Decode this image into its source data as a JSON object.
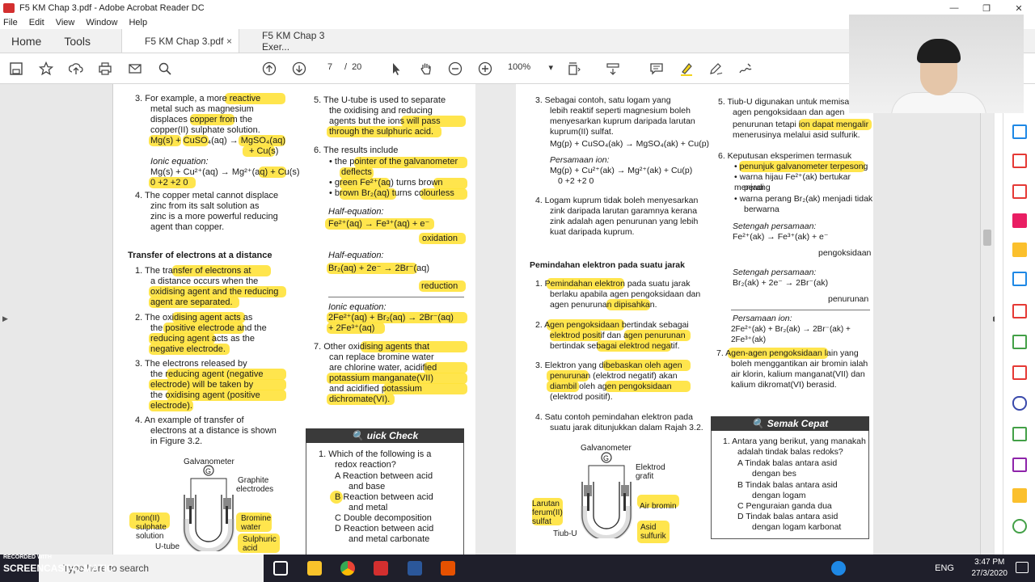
{
  "window": {
    "title": "F5 KM Chap 3.pdf - Adobe Acrobat Reader DC",
    "minimize": "—",
    "restore": "❐",
    "close": "✕"
  },
  "menu": [
    "File",
    "Edit",
    "View",
    "Window",
    "Help"
  ],
  "tabs": {
    "home": "Home",
    "tools": "Tools",
    "doc1": "F5 KM Chap 3.pdf",
    "doc1_close": "×",
    "doc2": "F5 KM Chap 3 Exer..."
  },
  "toolbar": {
    "page_current": "7",
    "page_sep": "/",
    "page_total": "20",
    "zoom": "100%",
    "zoom_arrow": "▾"
  },
  "page1": {
    "c1": {
      "l1": "3.   For example, a more reactive",
      "l2": "metal  such  as  magnesium",
      "l3": "displaces  copper  from  the",
      "l4": "copper(II) sulphate solution.",
      "l5": "Mg(s) + CuSO₄(aq) → MgSO₄(aq)",
      "l6": "+ Cu(s)",
      "l7": "Ionic equation:",
      "l8": "Mg(s) + Cu²⁺(aq) → Mg²⁺(aq) + Cu(s)",
      "l9": "0   +2             +2             0",
      "l10": "4.   The copper metal cannot displace",
      "l11": "zinc  from  its  salt  solution  as",
      "l12": "zinc is a more powerful reducing",
      "l13": "agent than copper.",
      "heading": "Transfer of electrons at a distance",
      "l14": "1.   The  transfer of electrons  at",
      "l15": "a  distance  occurs  when  the",
      "l16": "oxidising agent and the reducing",
      "l17": "agent are separated.",
      "l18": "2.   The  oxidising  agent  acts  as",
      "l19": "the  positive electrode  and  the",
      "l20": "reducing  agent  acts  as  the",
      "l21": "negative electrode.",
      "l22": "3.   The  electrons  released  by",
      "l23": "the  reducing agent  (negative",
      "l24": "electrode)  will  be  taken  by",
      "l25": "the  oxidising agent  (positive",
      "l26": "electrode).",
      "l27": "4.   An  example  of  transfer  of",
      "l28": "electrons at a distance is shown",
      "l29": "in Figure 3.2."
    },
    "c2": {
      "l1": "5.   The U-tube is used to separate",
      "l2": "the  oxidising  and  reducing",
      "l3": "agents but the ions will pass",
      "l4": "through the sulphuric acid.",
      "l5": "6.   The results include",
      "l6": "•  the pointer of the galvanometer",
      "l7": "deflects",
      "l8": "•  green Fe²⁺(aq) turns brown",
      "l9": "•  brown Br₂(aq) turns colourless",
      "l10": "Half-equation:",
      "l11": "Fe²⁺(aq) → Fe³⁺(aq) + e⁻",
      "l12": "oxidation",
      "l13": "Half-equation:",
      "l14": "Br₂(aq) + 2e⁻ → 2Br⁻(aq)",
      "l15": "reduction",
      "l16": "Ionic equation:",
      "l17": "2Fe²⁺(aq) + Br₂(aq) → 2Br⁻(aq)",
      "l18": "+ 2Fe³⁺(aq)",
      "l19": "7.   Other  oxidising agents  that",
      "l20": "can  replace  bromine  water",
      "l21": "are  chlorine  water,  acidified",
      "l22": "potassium  manganate(VII)",
      "l23": "and  acidified  potassium",
      "l24": "dichromate(VI)."
    },
    "fig": {
      "galv": "Galvanometer",
      "g": "G",
      "graphite": "Graphite",
      "electrodes": "electrodes",
      "iron1": "Iron(II)",
      "iron2": "sulphate",
      "iron3": "solution",
      "br1": "Bromine",
      "br2": "water",
      "sa1": "Sulphuric",
      "sa2": "acid",
      "utube": "U-tube"
    },
    "qc": {
      "title": "uick Check",
      "q1": "1.   Which of the following is a",
      "q2": "redox reaction?",
      "a1": "A   Reaction  between  acid",
      "a2": "and base",
      "b1": "B   Reaction  between  acid",
      "b2": "and metal",
      "c1": "C   Double decomposition",
      "d1": "D   Reaction  between  acid",
      "d2": "and metal carbonate"
    }
  },
  "page2": {
    "c1": {
      "l1": "3.   Sebagai  contoh,  satu  logam  yang",
      "l2": "lebih reaktif seperti magnesium boleh",
      "l3": "menyesarkan kuprum daripada larutan",
      "l4": "kuprum(II) sulfat.",
      "l5": "Mg(p) + CuSO₄(ak) → MgSO₄(ak) + Cu(p)",
      "l6": "Persamaan ion:",
      "l7": "Mg(p) + Cu²⁺(ak) → Mg²⁺(ak) + Cu(p)",
      "l8": "0         +2              +2              0",
      "l9": "4.   Logam kuprum tidak boleh menyesarkan",
      "l10": "zink daripada larutan garamnya kerana",
      "l11": "zink adalah agen penurunan yang lebih",
      "l12": "kuat daripada kuprum.",
      "heading": "Pemindahan elektron pada suatu jarak",
      "l13": "1.   Pemindahan elektron pada suatu jarak",
      "l14": "berlaku apabila agen pengoksidaan dan",
      "l15": "agen penurunan dipisahkan.",
      "l16": "2.   Agen pengoksidaan bertindak sebagai",
      "l17": "elektrod positif dan agen penurunan",
      "l18": "bertindak sebagai elektrod negatif.",
      "l19": "3.   Elektron yang dibebaskan oleh agen",
      "l20": "penurunan (elektrod negatif) akan",
      "l21": "diambil  oleh  agen pengoksidaan",
      "l22": "(elektrod positif).",
      "l23": "4.   Satu contoh pemindahan elektron pada",
      "l24": "suatu jarak ditunjukkan dalam Rajah 3.2."
    },
    "c2": {
      "l1": "5.   Tiub-U digunakan untuk memisahkan",
      "l2": "agen  pengoksidaan  dan  agen",
      "l3": "penurunan tetapi ion dapat mengalir",
      "l4": "menerusinya melalui asid sulfurik.",
      "l5": "6.   Keputusan eksperimen termasuk",
      "l6": "•  penunjuk galvanometer terpesong",
      "l7": "•  warna hijau Fe²⁺(ak) bertukar menjadi",
      "l8": "perang",
      "l9": "•  warna perang Br₂(ak) menjadi tidak",
      "l10": "berwarna",
      "l11": "Setengah persamaan:",
      "l12": "Fe²⁺(ak) → Fe³⁺(ak) + e⁻",
      "l13": "pengoksidaan",
      "l14": "Setengah persamaan:",
      "l15": "Br₂(ak) + 2e⁻ → 2Br⁻(ak)",
      "l16": "penurunan",
      "l17": "Persamaan ion:",
      "l18": "2Fe²⁺(ak) + Br₂(ak) → 2Br⁻(ak) + 2Fe³⁺(ak)",
      "l19": "7.   Agen-agen pengoksidaan lain yang",
      "l20": "boleh menggantikan air bromin ialah",
      "l21": "air klorin, kalium manganat(VII) dan",
      "l22": "kalium dikromat(VI) berasid."
    },
    "fig": {
      "galv": "Galvanometer",
      "g": "G",
      "el1": "Elektrod",
      "el2": "grafit",
      "lar1": "Larutan",
      "lar2": "ferum(II)",
      "lar3": "sulfat",
      "br": "Air bromin",
      "as1": "Asid",
      "as2": "sulfurik",
      "tiub": "Tiub-U"
    },
    "sc": {
      "title": "Semak Cepat",
      "q1": "1.   Antara yang berikut, yang manakah",
      "q2": "adalah tindak balas redoks?",
      "a1": "A   Tindak  balas  antara  asid",
      "a2": "dengan bes",
      "b1": "B   Tindak  balas  antara  asid",
      "b2": "dengan logam",
      "c1": "C   Penguraian ganda dua",
      "d1": "D   Tindak  balas  antara  asid",
      "d2": "dengan logam karbonat"
    }
  },
  "taskbar": {
    "recorded": "RECORDED WITH",
    "brand": "SCREENCAST-O-MATIC",
    "search": "Type here to search",
    "lang": "ENG",
    "time": "3:47 PM",
    "date": "27/3/2020"
  },
  "colors": {
    "highlight": "#ffe23a",
    "taskbar": "#1f1f2b",
    "acrobat_red": "#d32f2f"
  }
}
